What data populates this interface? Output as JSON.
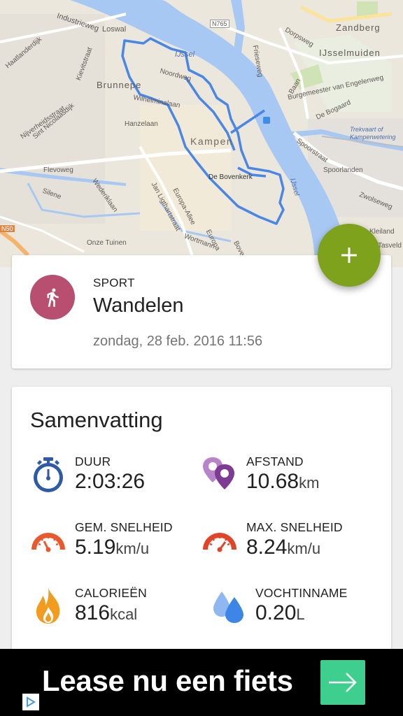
{
  "map": {
    "labels": [
      "Industrieweg",
      "Loswal",
      "Brunnepe",
      "Haatlanderdijk",
      "Kievitstraat",
      "IJssel",
      "N765",
      "Zandberg",
      "IJsselmuiden",
      "Dorpsweg",
      "Frieseweg",
      "Noordweg",
      "Wilhelminalaan",
      "Baan",
      "Burgemeester van Engelenweg",
      "De Bogaard",
      "Nijverheidsstraat",
      "Sint Nicolaasdijk",
      "Hanzelaan",
      "Kampen",
      "Trekvaart of Kamperwetering",
      "Flevoweg",
      "De Bovenkerk",
      "Spoorstraat",
      "Spoorlanden",
      "Silene",
      "Wederiklaan",
      "Jan Ligthartstraat",
      "IJssel",
      "Zwolseweg",
      "Europa-Allee",
      "N50",
      "Onze Tuinen",
      "Kleiland",
      "Tasveld",
      "Wortmann",
      "Europa",
      "Bove"
    ]
  },
  "fab": {
    "icon": "plus-icon"
  },
  "sport": {
    "caption": "SPORT",
    "name": "Wandelen",
    "date": "zondag, 28 feb. 2016 11:56",
    "icon": "walking-icon",
    "color": "#b84f70"
  },
  "summary": {
    "title": "Samenvatting",
    "stats": [
      {
        "label": "DUUR",
        "value": "2:03:26",
        "unit": "",
        "icon": "stopwatch-icon"
      },
      {
        "label": "AFSTAND",
        "value": "10.68",
        "unit": "km",
        "icon": "map-pins-icon"
      },
      {
        "label": "GEM. SNELHEID",
        "value": "5.19",
        "unit": "km/u",
        "icon": "speedometer-icon"
      },
      {
        "label": "MAX. SNELHEID",
        "value": "8.24",
        "unit": "km/u",
        "icon": "speedometer-max-icon"
      },
      {
        "label": "CALORIEËN",
        "value": "816",
        "unit": "kcal",
        "icon": "flame-icon"
      },
      {
        "label": "VOCHTINNAME",
        "value": "0.20",
        "unit": "L",
        "icon": "water-drops-icon"
      }
    ]
  },
  "ad": {
    "text": "Lease nu een fiets",
    "button_icon": "arrow-right-icon",
    "adchoices_icon": "adchoices-icon"
  },
  "colors": {
    "accent_green": "#7fa21d",
    "route_blue": "#4a86e8",
    "water": "#a7c8f2",
    "ad_button": "#3ecf8e"
  }
}
